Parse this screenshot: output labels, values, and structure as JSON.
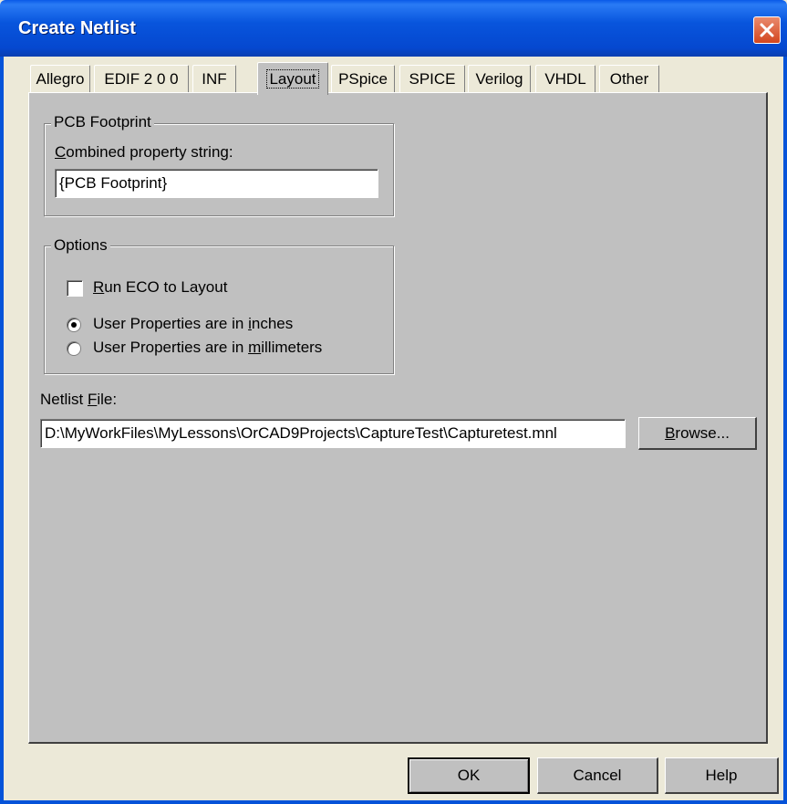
{
  "window": {
    "title": "Create Netlist"
  },
  "tabs": [
    {
      "label": "Allegro"
    },
    {
      "label": "EDIF 2 0 0"
    },
    {
      "label": "INF"
    },
    {
      "label": "Layout"
    },
    {
      "label": "PSpice"
    },
    {
      "label": "SPICE"
    },
    {
      "label": "Verilog"
    },
    {
      "label": "VHDL"
    },
    {
      "label": "Other"
    }
  ],
  "active_tab": "Layout",
  "pcb_footprint": {
    "group_label": "PCB Footprint",
    "combined_label_mnemonic": "C",
    "combined_label_rest": "ombined property string:",
    "value": "{PCB Footprint}"
  },
  "options": {
    "group_label": "Options",
    "run_eco": {
      "mnemonic": "R",
      "rest": "un ECO to Layout",
      "checked": false
    },
    "inches": {
      "before": "User Properties are in ",
      "mnemonic": "i",
      "after": "nches",
      "selected": true
    },
    "millimeters": {
      "before": "User Properties are in ",
      "mnemonic": "m",
      "after": "illimeters",
      "selected": false
    }
  },
  "netlist_file": {
    "label_before": "Netlist ",
    "label_mnemonic": "F",
    "label_after": "ile:",
    "value": "D:\\MyWorkFiles\\MyLessons\\OrCAD9Projects\\CaptureTest\\Capturetest.mnl",
    "browse_mnemonic": "B",
    "browse_rest": "rowse..."
  },
  "buttons": {
    "ok": "OK",
    "cancel": "Cancel",
    "help": "Help"
  }
}
